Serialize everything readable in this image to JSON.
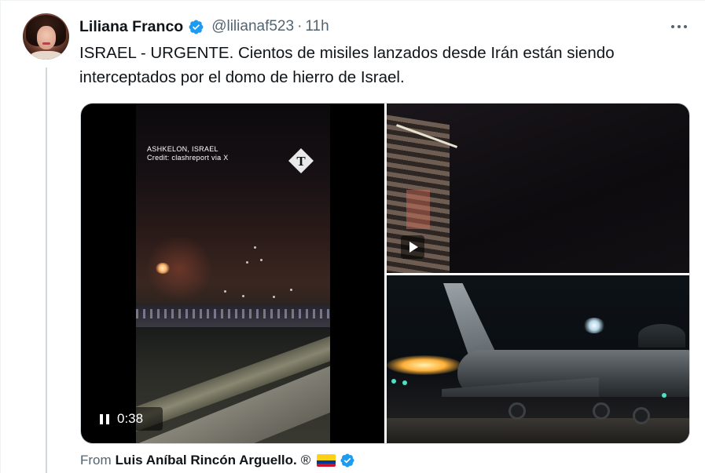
{
  "tweet": {
    "author_name": "Liliana Franco",
    "handle": "@lilianaf523",
    "separator": "·",
    "time": "11h",
    "text": "ISRAEL - URGENTE. Cientos de misiles lanzados desde Irán están siendo interceptados por el domo de hierro de Israel.",
    "more_icon": "more-horizontal-icon",
    "verified_color": "#1d9bf0"
  },
  "media": {
    "video": {
      "overlay_location": "ASHKELON, ISRAEL",
      "overlay_credit": "Credit: clashreport via X",
      "duration": "0:38",
      "logo": "telegraph-logo"
    },
    "photos": [
      {
        "kind": "video-thumbnail",
        "icon": "play-icon"
      },
      {
        "kind": "image"
      }
    ]
  },
  "source": {
    "from_label": "From",
    "name": "Luis Aníbal Rincón Arguello.",
    "registered_mark": "®",
    "flag_icon": "colombia-flag-icon",
    "verified_color": "#1d9bf0"
  }
}
